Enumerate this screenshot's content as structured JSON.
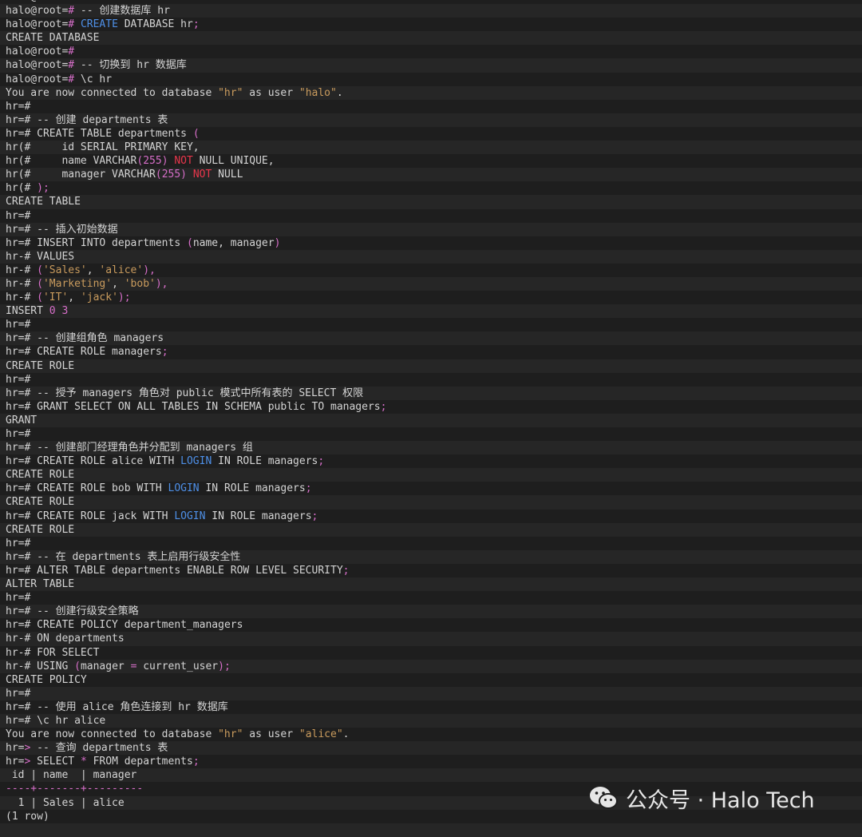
{
  "watermark": {
    "icon": "wechat-icon",
    "text": "公众号 · Halo Tech"
  },
  "lines": [
    [
      [
        "halo@root=#",
        "p"
      ]
    ],
    [
      [
        "halo@root=",
        "p"
      ],
      [
        "#",
        "o"
      ],
      [
        " -- 创建数据库 hr",
        "c"
      ]
    ],
    [
      [
        "halo@root=",
        "p"
      ],
      [
        "#",
        "o"
      ],
      [
        " ",
        "t"
      ],
      [
        "CREATE",
        "k"
      ],
      [
        " DATABASE hr",
        "t"
      ],
      [
        ";",
        "o"
      ]
    ],
    [
      [
        "CREATE DATABASE",
        "t"
      ]
    ],
    [
      [
        "halo@root=",
        "p"
      ],
      [
        "#",
        "o"
      ]
    ],
    [
      [
        "halo@root=",
        "p"
      ],
      [
        "#",
        "o"
      ],
      [
        " -- 切换到 hr 数据库",
        "c"
      ]
    ],
    [
      [
        "halo@root=",
        "p"
      ],
      [
        "#",
        "o"
      ],
      [
        " \\c hr",
        "t"
      ]
    ],
    [
      [
        "You are now connected to database ",
        "t"
      ],
      [
        "\"hr\"",
        "s"
      ],
      [
        " as user ",
        "t"
      ],
      [
        "\"halo\"",
        "s"
      ],
      [
        ".",
        "t"
      ]
    ],
    [
      [
        "hr=#",
        "p"
      ]
    ],
    [
      [
        "hr=#",
        "p"
      ],
      [
        " -- 创建 departments 表",
        "c"
      ]
    ],
    [
      [
        "hr=#",
        "p"
      ],
      [
        " CREATE TABLE departments ",
        "t"
      ],
      [
        "(",
        "o"
      ]
    ],
    [
      [
        "hr(",
        "p"
      ],
      [
        "#",
        "p"
      ],
      [
        "     id SERIAL PRIMARY KEY,",
        "t"
      ]
    ],
    [
      [
        "hr(",
        "p"
      ],
      [
        "#",
        "p"
      ],
      [
        "     name VARCHAR",
        "t"
      ],
      [
        "(",
        "o"
      ],
      [
        "255",
        "n"
      ],
      [
        ")",
        "o"
      ],
      [
        " ",
        "t"
      ],
      [
        "NOT",
        "r"
      ],
      [
        " NULL UNIQUE,",
        "t"
      ]
    ],
    [
      [
        "hr(",
        "p"
      ],
      [
        "#",
        "p"
      ],
      [
        "     manager VARCHAR",
        "t"
      ],
      [
        "(",
        "o"
      ],
      [
        "255",
        "n"
      ],
      [
        ")",
        "o"
      ],
      [
        " ",
        "t"
      ],
      [
        "NOT",
        "r"
      ],
      [
        " NULL",
        "t"
      ]
    ],
    [
      [
        "hr(",
        "p"
      ],
      [
        "#",
        "p"
      ],
      [
        " ",
        "t"
      ],
      [
        ");",
        "o"
      ]
    ],
    [
      [
        "CREATE TABLE",
        "t"
      ]
    ],
    [
      [
        "hr=#",
        "p"
      ]
    ],
    [
      [
        "hr=#",
        "p"
      ],
      [
        " -- 插入初始数据",
        "c"
      ]
    ],
    [
      [
        "hr=#",
        "p"
      ],
      [
        " INSERT INTO departments ",
        "t"
      ],
      [
        "(",
        "o"
      ],
      [
        "name, manager",
        "t"
      ],
      [
        ")",
        "o"
      ]
    ],
    [
      [
        "hr-#",
        "p"
      ],
      [
        " VALUES",
        "t"
      ]
    ],
    [
      [
        "hr-#",
        "p"
      ],
      [
        " ",
        "t"
      ],
      [
        "(",
        "o"
      ],
      [
        "'Sales'",
        "s"
      ],
      [
        ", ",
        "t"
      ],
      [
        "'alice'",
        "s"
      ],
      [
        "),",
        "o"
      ]
    ],
    [
      [
        "hr-#",
        "p"
      ],
      [
        " ",
        "t"
      ],
      [
        "(",
        "o"
      ],
      [
        "'Marketing'",
        "s"
      ],
      [
        ", ",
        "t"
      ],
      [
        "'bob'",
        "s"
      ],
      [
        "),",
        "o"
      ]
    ],
    [
      [
        "hr-#",
        "p"
      ],
      [
        " ",
        "t"
      ],
      [
        "(",
        "o"
      ],
      [
        "'IT'",
        "s"
      ],
      [
        ", ",
        "t"
      ],
      [
        "'jack'",
        "s"
      ],
      [
        ");",
        "o"
      ]
    ],
    [
      [
        "INSERT ",
        "t"
      ],
      [
        "0 3",
        "n"
      ]
    ],
    [
      [
        "hr=#",
        "p"
      ]
    ],
    [
      [
        "hr=#",
        "p"
      ],
      [
        " -- 创建组角色 managers",
        "c"
      ]
    ],
    [
      [
        "hr=#",
        "p"
      ],
      [
        " CREATE ROLE managers",
        "t"
      ],
      [
        ";",
        "o"
      ]
    ],
    [
      [
        "CREATE ROLE",
        "t"
      ]
    ],
    [
      [
        "hr=#",
        "p"
      ]
    ],
    [
      [
        "hr=#",
        "p"
      ],
      [
        " -- 授予 managers 角色对 public 模式中所有表的 SELECT 权限",
        "c"
      ]
    ],
    [
      [
        "hr=#",
        "p"
      ],
      [
        " GRANT SELECT ON ALL TABLES IN SCHEMA public TO managers",
        "t"
      ],
      [
        ";",
        "o"
      ]
    ],
    [
      [
        "GRANT",
        "t"
      ]
    ],
    [
      [
        "hr=#",
        "p"
      ]
    ],
    [
      [
        "hr=#",
        "p"
      ],
      [
        " -- 创建部门经理角色并分配到 managers 组",
        "c"
      ]
    ],
    [
      [
        "hr=#",
        "p"
      ],
      [
        " CREATE ROLE alice WITH ",
        "t"
      ],
      [
        "LOGIN",
        "k"
      ],
      [
        " IN ROLE managers",
        "t"
      ],
      [
        ";",
        "o"
      ]
    ],
    [
      [
        "CREATE ROLE",
        "t"
      ]
    ],
    [
      [
        "hr=#",
        "p"
      ],
      [
        " CREATE ROLE bob WITH ",
        "t"
      ],
      [
        "LOGIN",
        "k"
      ],
      [
        " IN ROLE managers",
        "t"
      ],
      [
        ";",
        "o"
      ]
    ],
    [
      [
        "CREATE ROLE",
        "t"
      ]
    ],
    [
      [
        "hr=#",
        "p"
      ],
      [
        " CREATE ROLE jack WITH ",
        "t"
      ],
      [
        "LOGIN",
        "k"
      ],
      [
        " IN ROLE managers",
        "t"
      ],
      [
        ";",
        "o"
      ]
    ],
    [
      [
        "CREATE ROLE",
        "t"
      ]
    ],
    [
      [
        "hr=#",
        "p"
      ]
    ],
    [
      [
        "hr=#",
        "p"
      ],
      [
        " -- 在 departments 表上启用行级安全性",
        "c"
      ]
    ],
    [
      [
        "hr=#",
        "p"
      ],
      [
        " ALTER TABLE departments ENABLE ROW LEVEL SECURITY",
        "t"
      ],
      [
        ";",
        "o"
      ]
    ],
    [
      [
        "ALTER TABLE",
        "t"
      ]
    ],
    [
      [
        "hr=#",
        "p"
      ]
    ],
    [
      [
        "hr=#",
        "p"
      ],
      [
        " -- 创建行级安全策略",
        "c"
      ]
    ],
    [
      [
        "hr=#",
        "p"
      ],
      [
        " CREATE POLICY department_managers",
        "t"
      ]
    ],
    [
      [
        "hr-#",
        "p"
      ],
      [
        " ON departments",
        "t"
      ]
    ],
    [
      [
        "hr-#",
        "p"
      ],
      [
        " FOR SELECT",
        "t"
      ]
    ],
    [
      [
        "hr-#",
        "p"
      ],
      [
        " USING ",
        "t"
      ],
      [
        "(",
        "o"
      ],
      [
        "manager ",
        "t"
      ],
      [
        "=",
        "o"
      ],
      [
        " current_user",
        "t"
      ],
      [
        ");",
        "o"
      ]
    ],
    [
      [
        "CREATE POLICY",
        "t"
      ]
    ],
    [
      [
        "hr=#",
        "p"
      ]
    ],
    [
      [
        "hr=#",
        "p"
      ],
      [
        " -- 使用 alice 角色连接到 hr 数据库",
        "c"
      ]
    ],
    [
      [
        "hr=#",
        "p"
      ],
      [
        " \\c hr alice",
        "t"
      ]
    ],
    [
      [
        "You are now connected to database ",
        "t"
      ],
      [
        "\"hr\"",
        "s"
      ],
      [
        " as user ",
        "t"
      ],
      [
        "\"alice\"",
        "s"
      ],
      [
        ".",
        "t"
      ]
    ],
    [
      [
        "hr=",
        "p"
      ],
      [
        ">",
        "o"
      ],
      [
        " -- 查询 departments 表",
        "c"
      ]
    ],
    [
      [
        "hr=",
        "p"
      ],
      [
        ">",
        "o"
      ],
      [
        " SELECT ",
        "t"
      ],
      [
        "*",
        "o"
      ],
      [
        " FROM departments",
        "t"
      ],
      [
        ";",
        "o"
      ]
    ],
    [
      [
        " id | name  | manager",
        "t"
      ]
    ],
    [
      [
        "----+-------+---------",
        "x"
      ]
    ],
    [
      [
        "  1 | Sales | alice",
        "t"
      ]
    ],
    [
      [
        "(1 row)",
        "t"
      ]
    ],
    [
      [
        "",
        "t"
      ]
    ]
  ]
}
